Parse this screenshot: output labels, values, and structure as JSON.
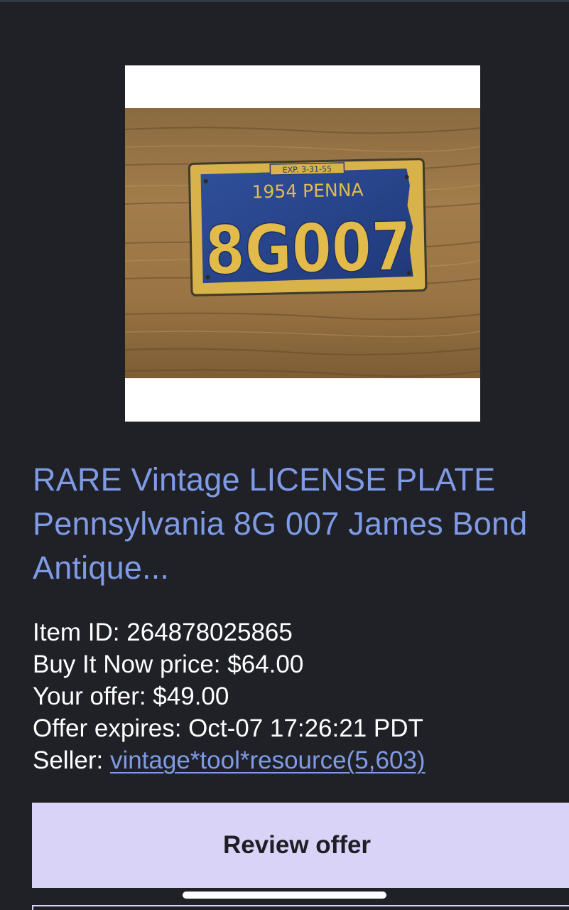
{
  "listing": {
    "image_alt": "1954 Pennsylvania license plate 8G007",
    "plate": {
      "expiration": "EXP. 3-31-55",
      "year_state": "1954 PENNA",
      "number": "8G007"
    },
    "title": "RARE Vintage LICENSE PLATE Pennsylvania 8G 007 James Bond Antique..."
  },
  "details": {
    "item_id_label": "Item ID: ",
    "item_id": "264878025865",
    "buy_it_now_label": "Buy It Now price: ",
    "buy_it_now": "$64.00",
    "your_offer_label": "Your offer: ",
    "your_offer": "$49.00",
    "offer_expires_label": "Offer expires: ",
    "offer_expires": "Oct-07 17:26:21 PDT",
    "seller_label": "Seller: ",
    "seller": "vintage*tool*resource(5,603)"
  },
  "actions": {
    "review_offer": "Review offer"
  },
  "colors": {
    "background": "#202127",
    "link": "#7f9be6",
    "button": "#d9d3f7",
    "text": "#ffffff"
  }
}
